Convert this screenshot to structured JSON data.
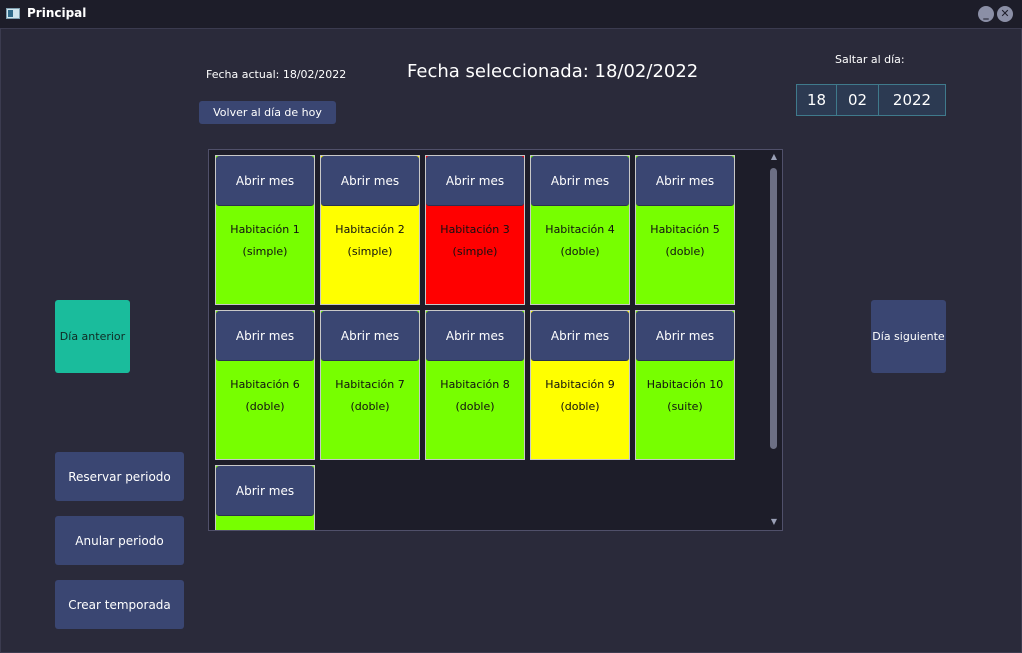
{
  "window": {
    "title": "Principal",
    "minimize": "_",
    "close": "✕"
  },
  "header": {
    "current_date": "Fecha actual: 18/02/2022",
    "selected_date": "Fecha seleccionada: 18/02/2022",
    "today_button": "Volver al día de hoy",
    "jump_label": "Saltar al día:",
    "jump_day": "18",
    "jump_month": "02",
    "jump_year": "2022"
  },
  "nav": {
    "prev_day": "Día anterior",
    "next_day": "Día siguiente"
  },
  "actions": {
    "reserve": "Reservar periodo",
    "cancel": "Anular periodo",
    "season": "Crear temporada"
  },
  "colors": {
    "free": "#77ff00",
    "partial": "#ffff00",
    "occupied": "#ff0000"
  },
  "rooms": [
    {
      "button": "Abrir mes",
      "name": "Habitación 1",
      "type": "(simple)",
      "color": "#77ff00"
    },
    {
      "button": "Abrir mes",
      "name": "Habitación 2",
      "type": "(simple)",
      "color": "#ffff00"
    },
    {
      "button": "Abrir mes",
      "name": "Habitación 3",
      "type": "(simple)",
      "color": "#ff0000"
    },
    {
      "button": "Abrir mes",
      "name": "Habitación 4",
      "type": "(doble)",
      "color": "#77ff00"
    },
    {
      "button": "Abrir mes",
      "name": "Habitación 5",
      "type": "(doble)",
      "color": "#77ff00"
    },
    {
      "button": "Abrir mes",
      "name": "Habitación 6",
      "type": "(doble)",
      "color": "#77ff00"
    },
    {
      "button": "Abrir mes",
      "name": "Habitación 7",
      "type": "(doble)",
      "color": "#77ff00"
    },
    {
      "button": "Abrir mes",
      "name": "Habitación 8",
      "type": "(doble)",
      "color": "#77ff00"
    },
    {
      "button": "Abrir mes",
      "name": "Habitación 9",
      "type": "(doble)",
      "color": "#ffff00"
    },
    {
      "button": "Abrir mes",
      "name": "Habitación 10",
      "type": "(suite)",
      "color": "#77ff00"
    },
    {
      "button": "Abrir mes",
      "name": "",
      "type": "",
      "color": "#77ff00"
    }
  ],
  "scrollbar": {
    "up_icon": "▲",
    "down_icon": "▼"
  }
}
